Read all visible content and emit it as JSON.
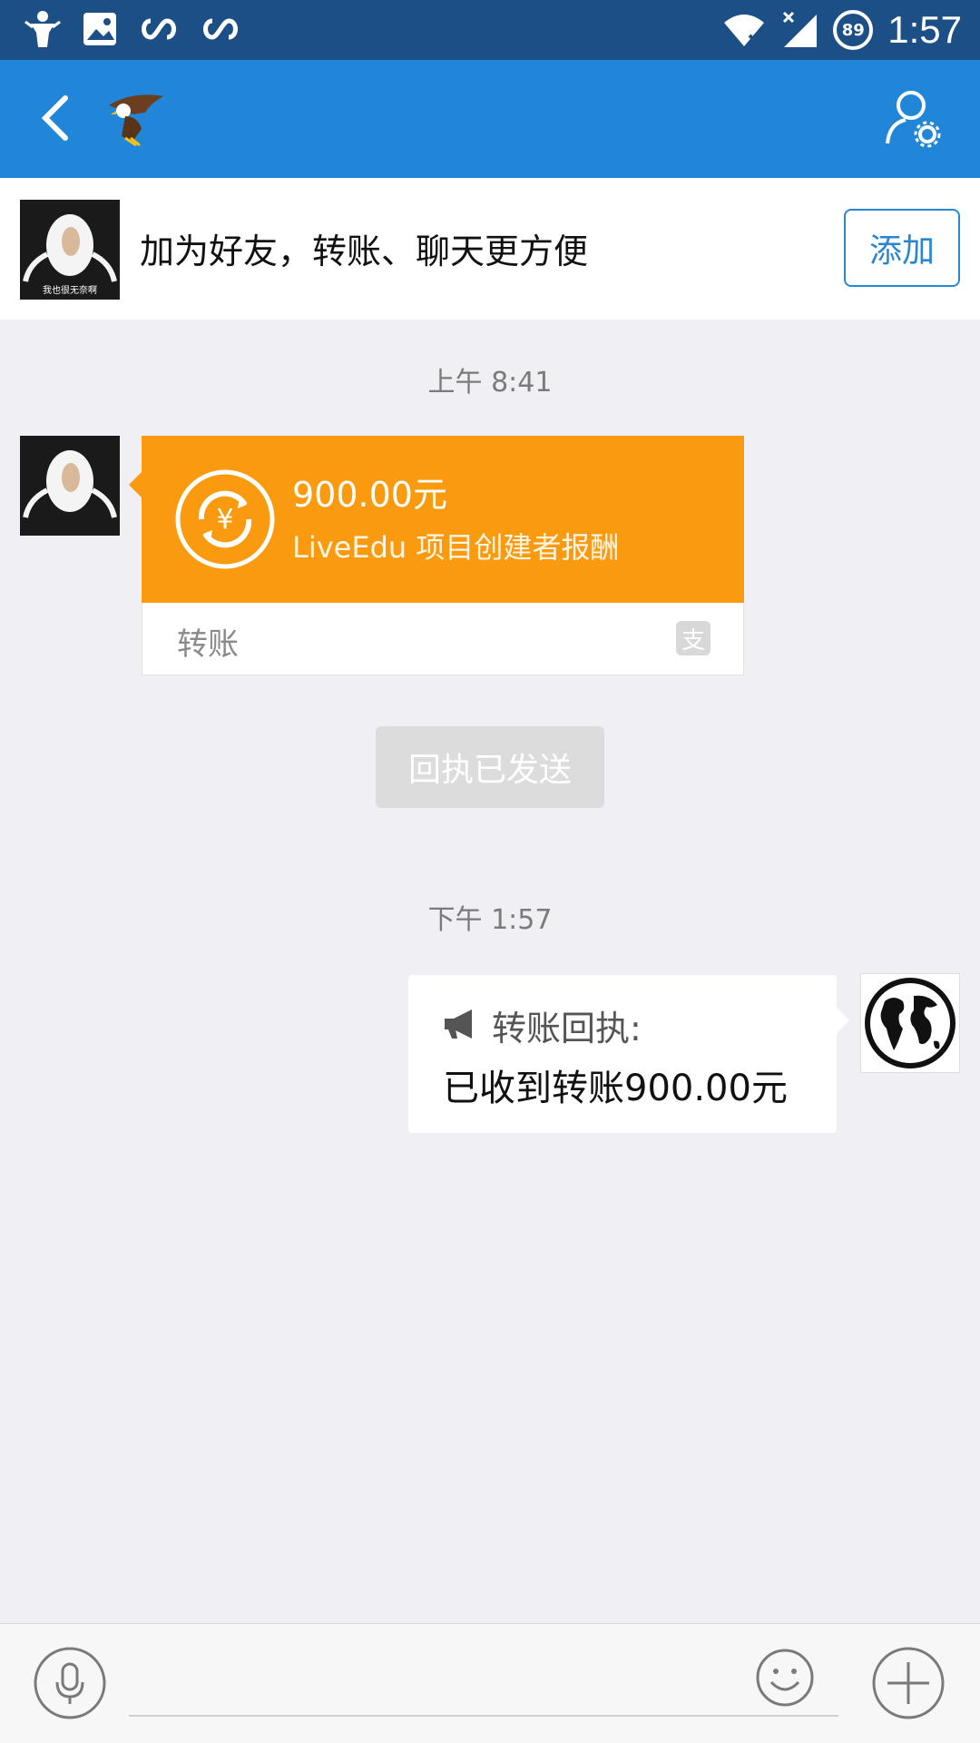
{
  "status_bar": {
    "time": "1:57",
    "battery_level": "89"
  },
  "nav": {
    "back_icon": "chevron-left-icon",
    "profile_settings_icon": "person-gear-icon"
  },
  "banner": {
    "text": "加为好友，转账、聊天更方便",
    "add_label": "添加",
    "avatar_caption": "我也很无奈啊"
  },
  "chat": {
    "timestamp_1": "上午 8:41",
    "transfer": {
      "amount": "900.00元",
      "note": "LiveEdu 项目创建者报酬",
      "type_label": "转账",
      "alipay_glyph": "支"
    },
    "receipt_sent_label": "回执已发送",
    "timestamp_2": "下午 1:57",
    "receipt_message": {
      "title": "转账回执:",
      "body": "已收到转账900.00元"
    }
  },
  "colors": {
    "status_bar": "#1c4f86",
    "nav_bar": "#2286d8",
    "transfer_orange": "#fa9a0e",
    "background": "#efeff4",
    "accent_blue": "#2b86d1"
  }
}
